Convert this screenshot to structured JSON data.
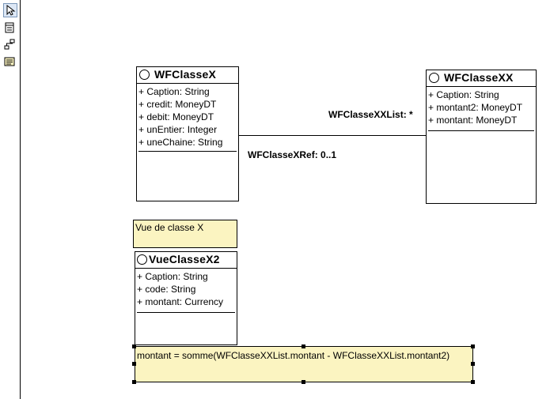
{
  "toolbar": {
    "tools": [
      {
        "icon": "pointer-arrow-icon",
        "selected": true
      },
      {
        "icon": "class-icon",
        "selected": false
      },
      {
        "icon": "association-icon",
        "selected": false
      },
      {
        "icon": "note-icon",
        "selected": false
      }
    ]
  },
  "diagram": {
    "class_x": {
      "name": "WFClasseX",
      "attributes": [
        "+ Caption: String",
        "+ credit: MoneyDT",
        "+ debit: MoneyDT",
        "+ unEntier: Integer",
        "+ uneChaine: String"
      ]
    },
    "class_xx": {
      "name": "WFClasseXX",
      "attributes": [
        "+ Caption: String",
        "+ montant2: MoneyDT",
        "+ montant: MoneyDT"
      ]
    },
    "association": {
      "role_to_xx": "WFClasseXXList: *",
      "role_to_x": "WFClasseXRef: 0..1"
    },
    "note_view": "Vue de classe X",
    "class_view": {
      "name": "VueClasseX2",
      "attributes": [
        "+ Caption: String",
        "+ code: String",
        "+ montant: Currency"
      ]
    },
    "note_formula": "montant = somme(WFClasseXXList.montant - WFClasseXXList.montant2)"
  }
}
